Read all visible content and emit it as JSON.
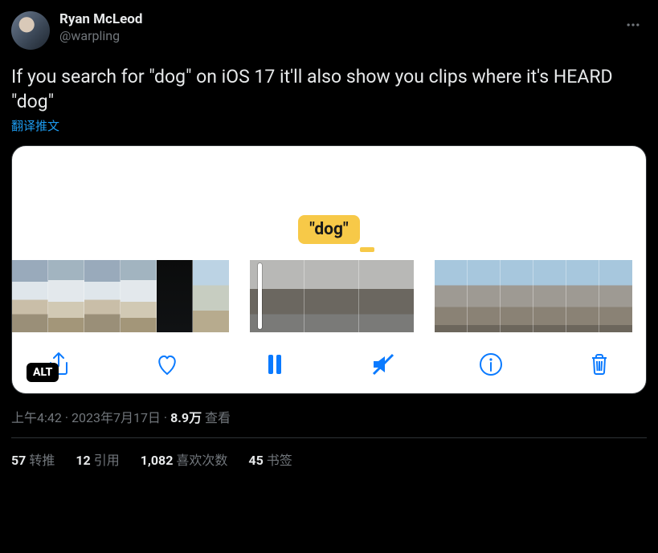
{
  "author": {
    "display_name": "Ryan McLeod",
    "handle": "@warpling"
  },
  "tweet_text": "If you search for \"dog\" on iOS 17 it'll also show you clips where it's HEARD \"dog\"",
  "translate_label": "翻译推文",
  "media": {
    "caption_bubble": "\"dog\"",
    "alt_badge": "ALT",
    "toolbar_icons": {
      "share": "share-icon",
      "like": "heart-icon",
      "pause": "pause-icon",
      "mute": "mute-icon",
      "info": "info-icon",
      "trash": "trash-icon"
    }
  },
  "meta": {
    "time": "上午4:42",
    "sep1": " · ",
    "date": "2023年7月17日",
    "sep2": " · ",
    "views_num": "8.9万",
    "views_label": " 查看"
  },
  "stats": {
    "retweets": {
      "num": "57",
      "label": "转推"
    },
    "quotes": {
      "num": "12",
      "label": "引用"
    },
    "likes": {
      "num": "1,082",
      "label": "喜欢次数"
    },
    "bookmarks": {
      "num": "45",
      "label": "书签"
    }
  }
}
